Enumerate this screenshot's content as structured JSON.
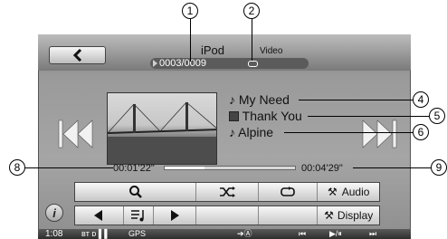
{
  "header": {
    "back_icon": "chevron-left-icon",
    "title": "iPod",
    "subtitle": "Video",
    "track_counter": "0003/0009"
  },
  "now_playing": {
    "song": "My Need",
    "album": "Thank You",
    "artist": "Alpine"
  },
  "time": {
    "elapsed": "00:01'22\"",
    "total": "00:04'29\"",
    "progress_fraction": 0.305
  },
  "controls_row1": {
    "search_icon": "search-icon",
    "shuffle_icon": "shuffle-icon",
    "repeat_icon": "repeat-icon",
    "audio_label": "Audio"
  },
  "controls_row2": {
    "prev_icon": "triangle-left-icon",
    "list_icon": "music-list-icon",
    "next_icon": "triangle-right-icon",
    "display_label": "Display"
  },
  "info_button": "i",
  "status_bar": {
    "clock": "1:08",
    "gps": "GPS"
  },
  "callouts": [
    "1",
    "2",
    "4",
    "5",
    "6",
    "8",
    "9"
  ]
}
